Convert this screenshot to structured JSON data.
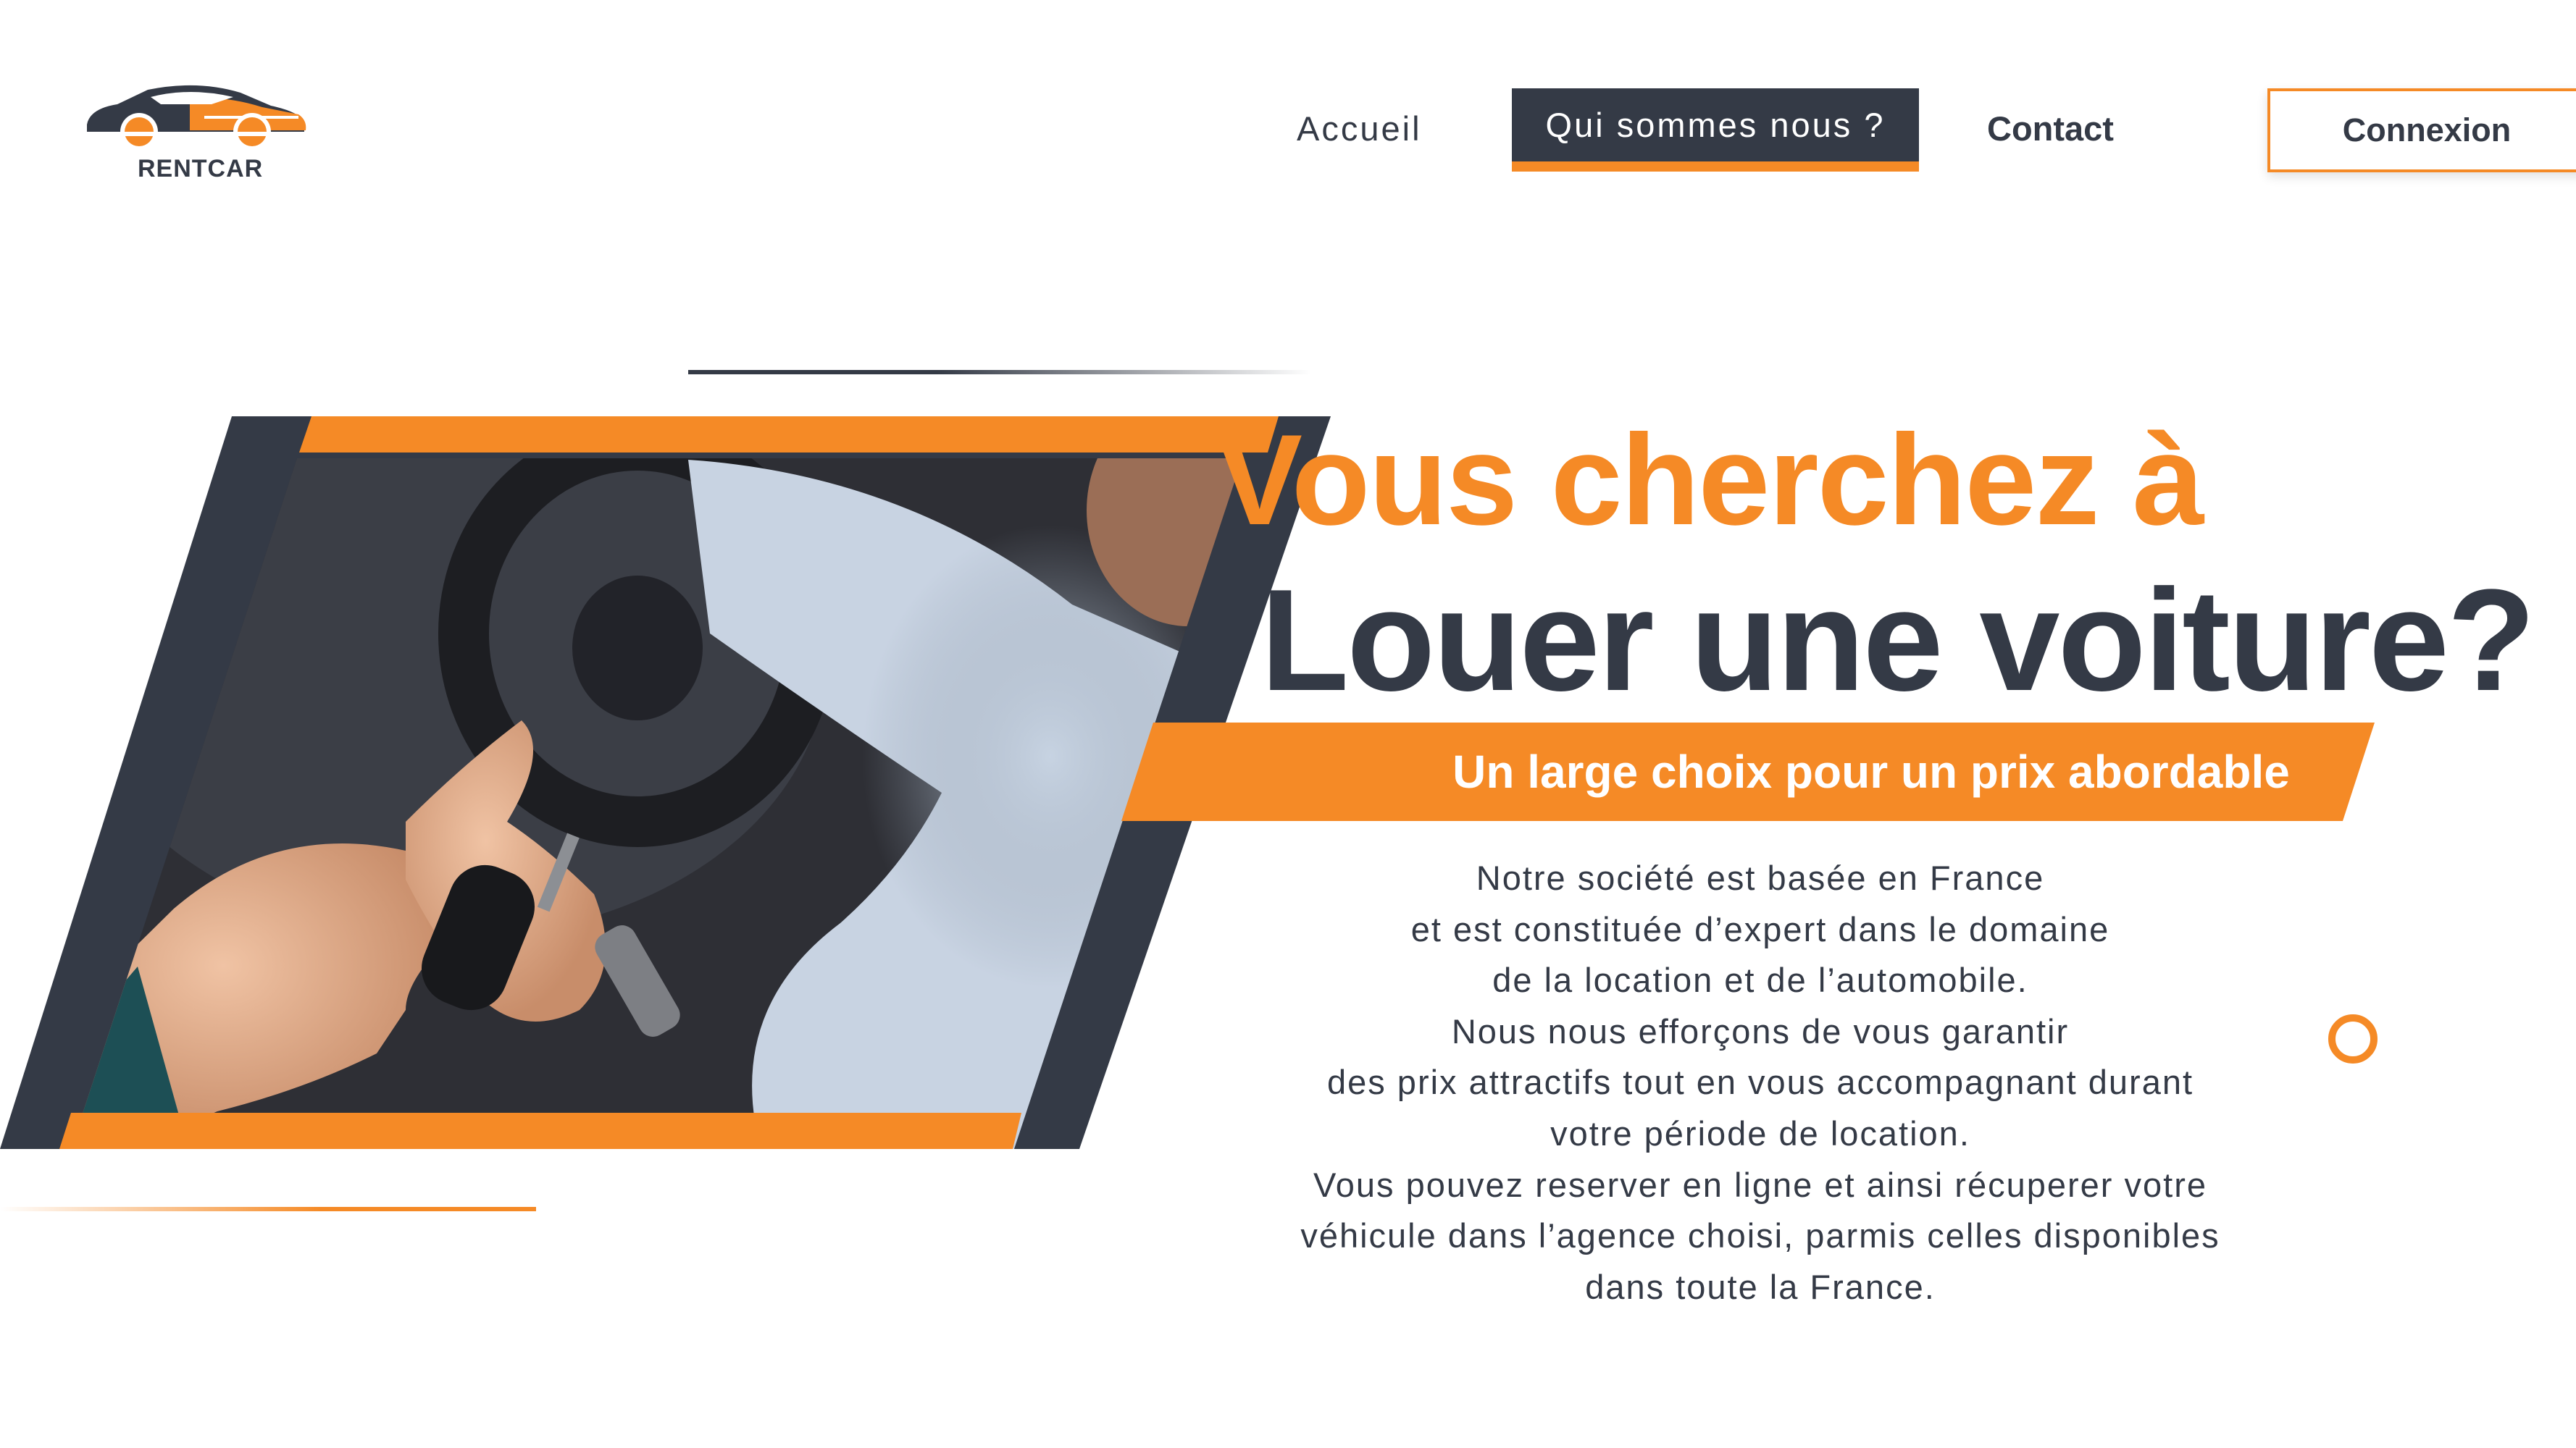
{
  "brand": {
    "name": "RENTCAR"
  },
  "nav": {
    "items": [
      {
        "label": "Accueil"
      },
      {
        "label": "Qui sommes nous ?"
      },
      {
        "label": "Contact"
      }
    ],
    "login_label": "Connexion"
  },
  "hero": {
    "title_line1": "Vous cherchez à",
    "title_line2": "Louer une voiture?",
    "banner": "Un large choix pour un prix abordable",
    "paragraph": [
      "Notre société est basée en France",
      "et est constituée d’expert dans le domaine",
      "de la location et de l’automobile.",
      "Nous nous efforçons de vous garantir",
      "des prix attractifs tout en vous accompagnant durant",
      "votre période de location.",
      "Vous pouvez reserver en ligne et ainsi récuperer votre",
      "véhicule dans l’agence choisi, parmis celles disponibles",
      "dans toute la France."
    ]
  },
  "colors": {
    "accent": "#f58a26",
    "dark": "#343a46",
    "background": "#ffffff"
  },
  "icons": [
    "car-logo-icon",
    "circle-ring-icon"
  ]
}
